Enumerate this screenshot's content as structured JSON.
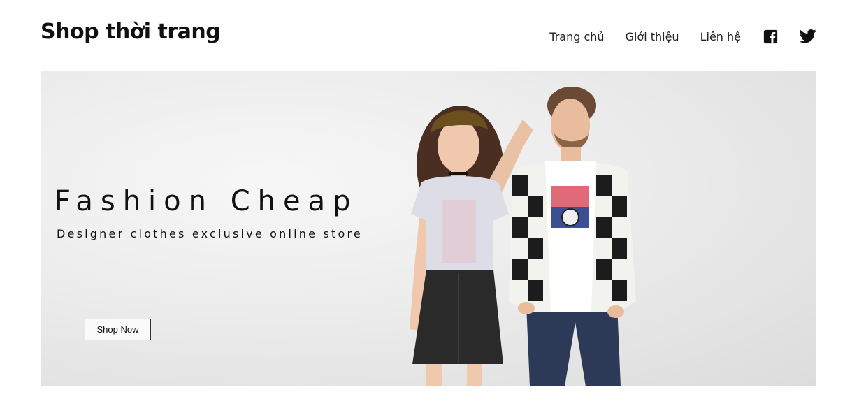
{
  "header": {
    "brand": "Shop thời trang",
    "nav": [
      {
        "label": "Trang chủ"
      },
      {
        "label": "Giới thiệu"
      },
      {
        "label": "Liên hệ"
      }
    ],
    "social": [
      {
        "icon": "facebook-icon"
      },
      {
        "icon": "twitter-icon"
      }
    ]
  },
  "hero": {
    "title": "Fashion Cheap",
    "subtitle": "Designer clothes exclusive online store",
    "button_label": "Shop Now"
  },
  "colors": {
    "text": "#111111",
    "hero_bg": "#e8e8e8"
  }
}
